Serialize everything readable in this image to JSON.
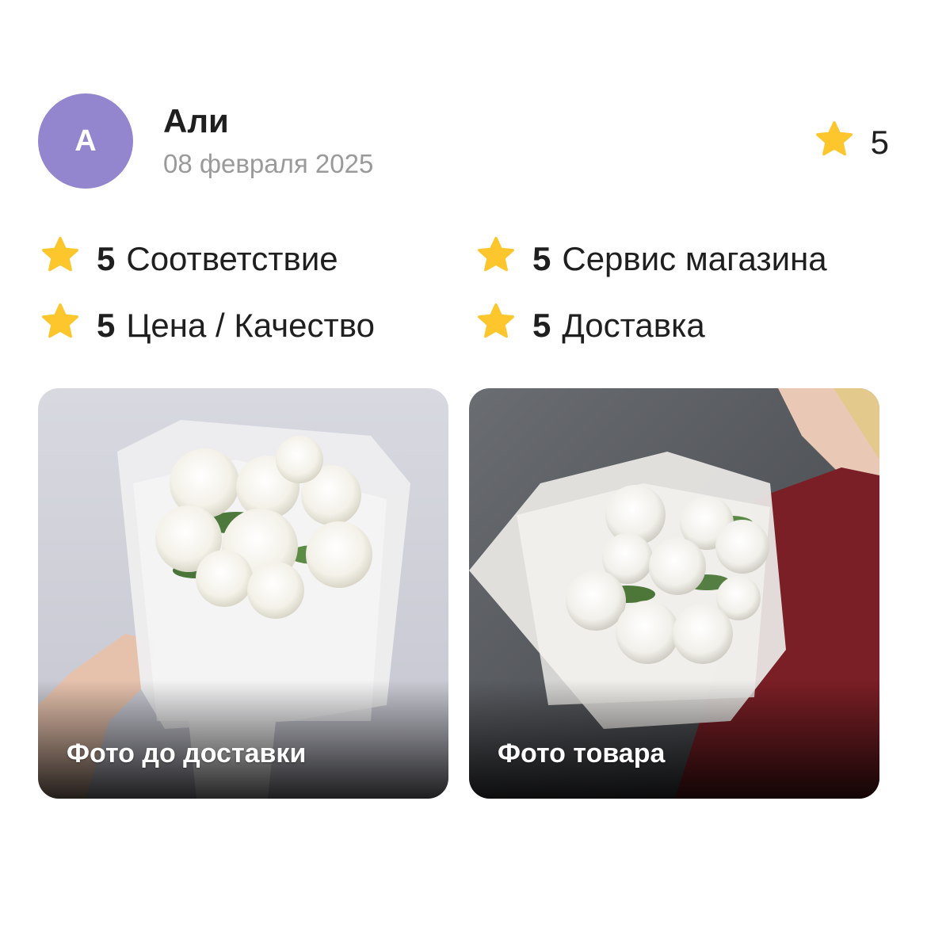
{
  "review": {
    "avatar_letter": "А",
    "author": "Али",
    "date": "08 февраля 2025",
    "overall_rating": "5",
    "criteria": [
      {
        "value": "5",
        "label": "Соответствие"
      },
      {
        "value": "5",
        "label": "Сервис магазина"
      },
      {
        "value": "5",
        "label": "Цена / Качество"
      },
      {
        "value": "5",
        "label": "Доставка"
      }
    ],
    "photos": [
      {
        "caption": "Фото до доставки"
      },
      {
        "caption": "Фото товара"
      }
    ]
  },
  "colors": {
    "avatar": "#9485cf",
    "star": "#fdc62c",
    "date_text": "#9a9a9a"
  }
}
